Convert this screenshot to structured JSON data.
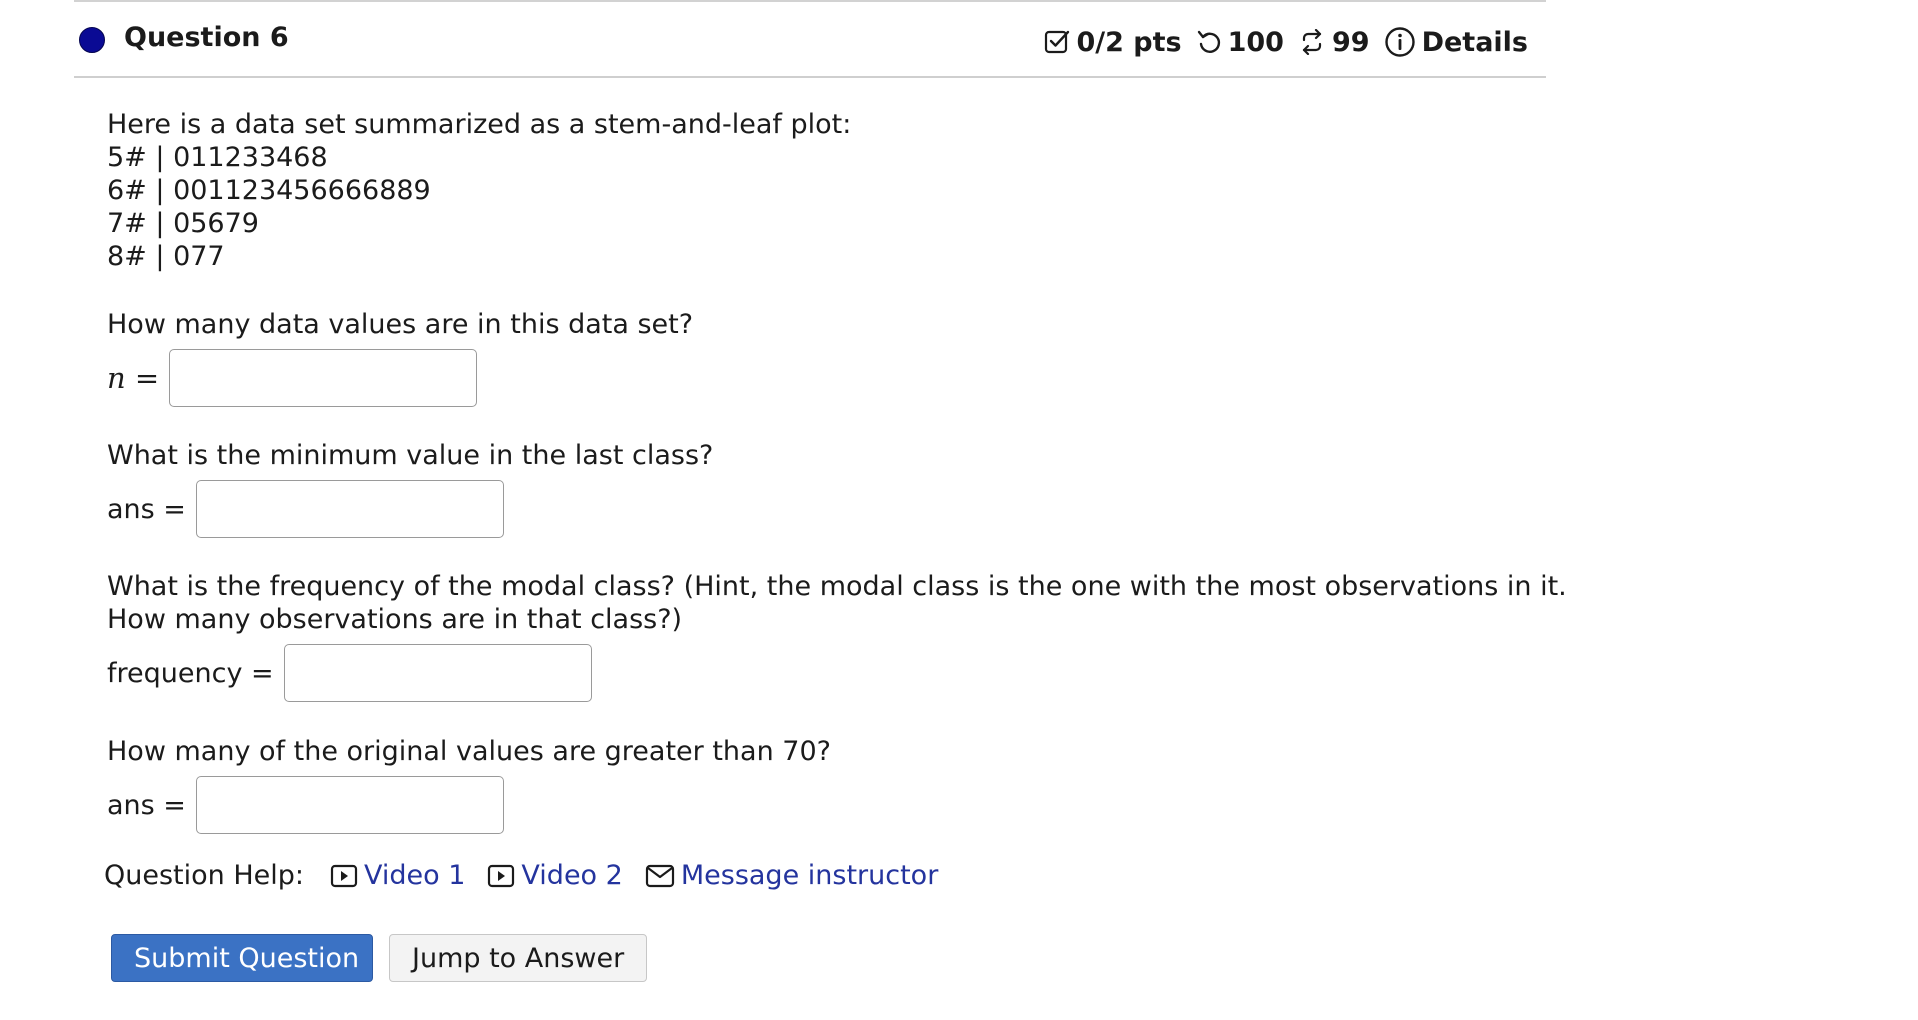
{
  "question": {
    "title": "Question 6",
    "status_color": "#0a0a94",
    "meta": {
      "points_icon": "checkbox-icon",
      "points": "0/2 pts",
      "attempts_icon": "undo-icon",
      "attempts": "100",
      "retries_icon": "repeat-icon",
      "retries": "99",
      "details_icon": "info-icon",
      "details_label": "Details"
    }
  },
  "body": {
    "intro": "Here is a data set summarized as a stem-and-leaf plot:",
    "stem_leaf": [
      "5# | 011233468",
      "6# | 001123456666889",
      "7# | 05679",
      "8# | 077"
    ],
    "parts": [
      {
        "prompt": "How many data values are in this data set?",
        "label": "n =",
        "value": ""
      },
      {
        "prompt": "What is the minimum value in the last class?",
        "label": "ans =",
        "value": ""
      },
      {
        "prompt_line1": "What is the frequency of the modal class? (Hint, the modal class is the one with the most observations in it.",
        "prompt_line2": "How many observations are in that class?)",
        "label": "frequency =",
        "value": ""
      },
      {
        "prompt": "How many of the original values are greater than 70?",
        "label": "ans =",
        "value": ""
      }
    ]
  },
  "help": {
    "label": "Question Help:",
    "links": [
      {
        "icon": "video-icon",
        "label": "Video 1"
      },
      {
        "icon": "video-icon",
        "label": "Video 2"
      },
      {
        "icon": "mail-icon",
        "label": "Message instructor"
      }
    ],
    "link_color": "#24349e"
  },
  "actions": {
    "submit_label": "Submit Question",
    "jump_label": "Jump to Answer",
    "submit_color": "#3b72c4"
  }
}
